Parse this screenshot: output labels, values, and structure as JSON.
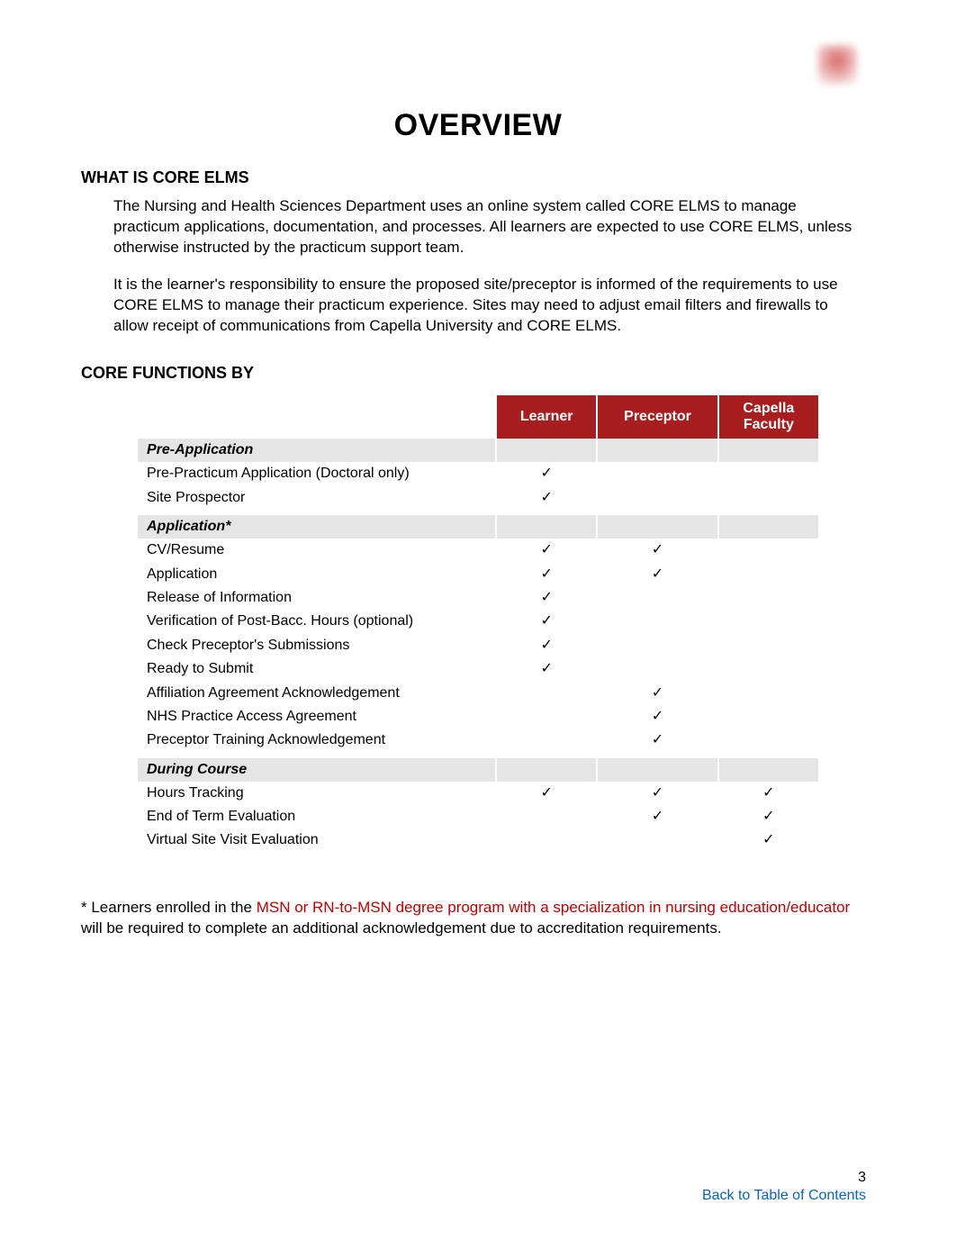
{
  "page_title": "OVERVIEW",
  "sections": {
    "what_is": {
      "heading": "WHAT IS CORE ELMS",
      "p1": "The Nursing and Health Sciences Department uses an online system called CORE ELMS to manage practicum applications, documentation, and processes. All learners are expected to use CORE ELMS, unless otherwise instructed by the practicum support team.",
      "p2": "It is the learner's responsibility to ensure the proposed site/preceptor is informed of the requirements to use CORE ELMS to manage their practicum experience. Sites may need to adjust email filters and firewalls to allow receipt of communications from Capella University and CORE ELMS."
    },
    "core_functions": {
      "heading": "CORE FUNCTIONS BY"
    }
  },
  "table": {
    "headers": {
      "learner": "Learner",
      "preceptor": "Preceptor",
      "faculty_line1": "Capella",
      "faculty_line2": "Faculty"
    },
    "check": "✓",
    "groups": [
      {
        "title": "Pre-Application",
        "rows": [
          {
            "label": "Pre-Practicum Application (Doctoral only)",
            "learner": true,
            "preceptor": false,
            "faculty": false
          },
          {
            "label": "Site Prospector",
            "learner": true,
            "preceptor": false,
            "faculty": false
          }
        ]
      },
      {
        "title": "Application*",
        "rows": [
          {
            "label": "CV/Resume",
            "learner": true,
            "preceptor": true,
            "faculty": false
          },
          {
            "label": "Application",
            "learner": true,
            "preceptor": true,
            "faculty": false
          },
          {
            "label": "Release of Information",
            "learner": true,
            "preceptor": false,
            "faculty": false
          },
          {
            "label": "Verification of Post-Bacc. Hours (optional)",
            "learner": true,
            "preceptor": false,
            "faculty": false
          },
          {
            "label": "Check Preceptor's Submissions",
            "learner": true,
            "preceptor": false,
            "faculty": false
          },
          {
            "label": "Ready to Submit",
            "learner": true,
            "preceptor": false,
            "faculty": false
          },
          {
            "label": "Affiliation Agreement Acknowledgement",
            "learner": false,
            "preceptor": true,
            "faculty": false
          },
          {
            "label": "NHS Practice Access Agreement",
            "learner": false,
            "preceptor": true,
            "faculty": false
          },
          {
            "label": "Preceptor Training Acknowledgement",
            "learner": false,
            "preceptor": true,
            "faculty": false
          }
        ]
      },
      {
        "title": "During Course",
        "rows": [
          {
            "label": "Hours Tracking",
            "learner": true,
            "preceptor": true,
            "faculty": true
          },
          {
            "label": "End of Term Evaluation",
            "learner": false,
            "preceptor": true,
            "faculty": true
          },
          {
            "label": "Virtual Site Visit Evaluation",
            "learner": false,
            "preceptor": false,
            "faculty": true
          }
        ]
      }
    ]
  },
  "footnote": {
    "prefix": "* Learners enrolled in the ",
    "highlight": "MSN or RN-to-MSN degree program with a specialization in nursing education/educator",
    "suffix": " will be required to complete an additional acknowledgement due to accreditation requirements."
  },
  "footer": {
    "page_number": "3",
    "toc_label": "Back to Table of Contents"
  }
}
